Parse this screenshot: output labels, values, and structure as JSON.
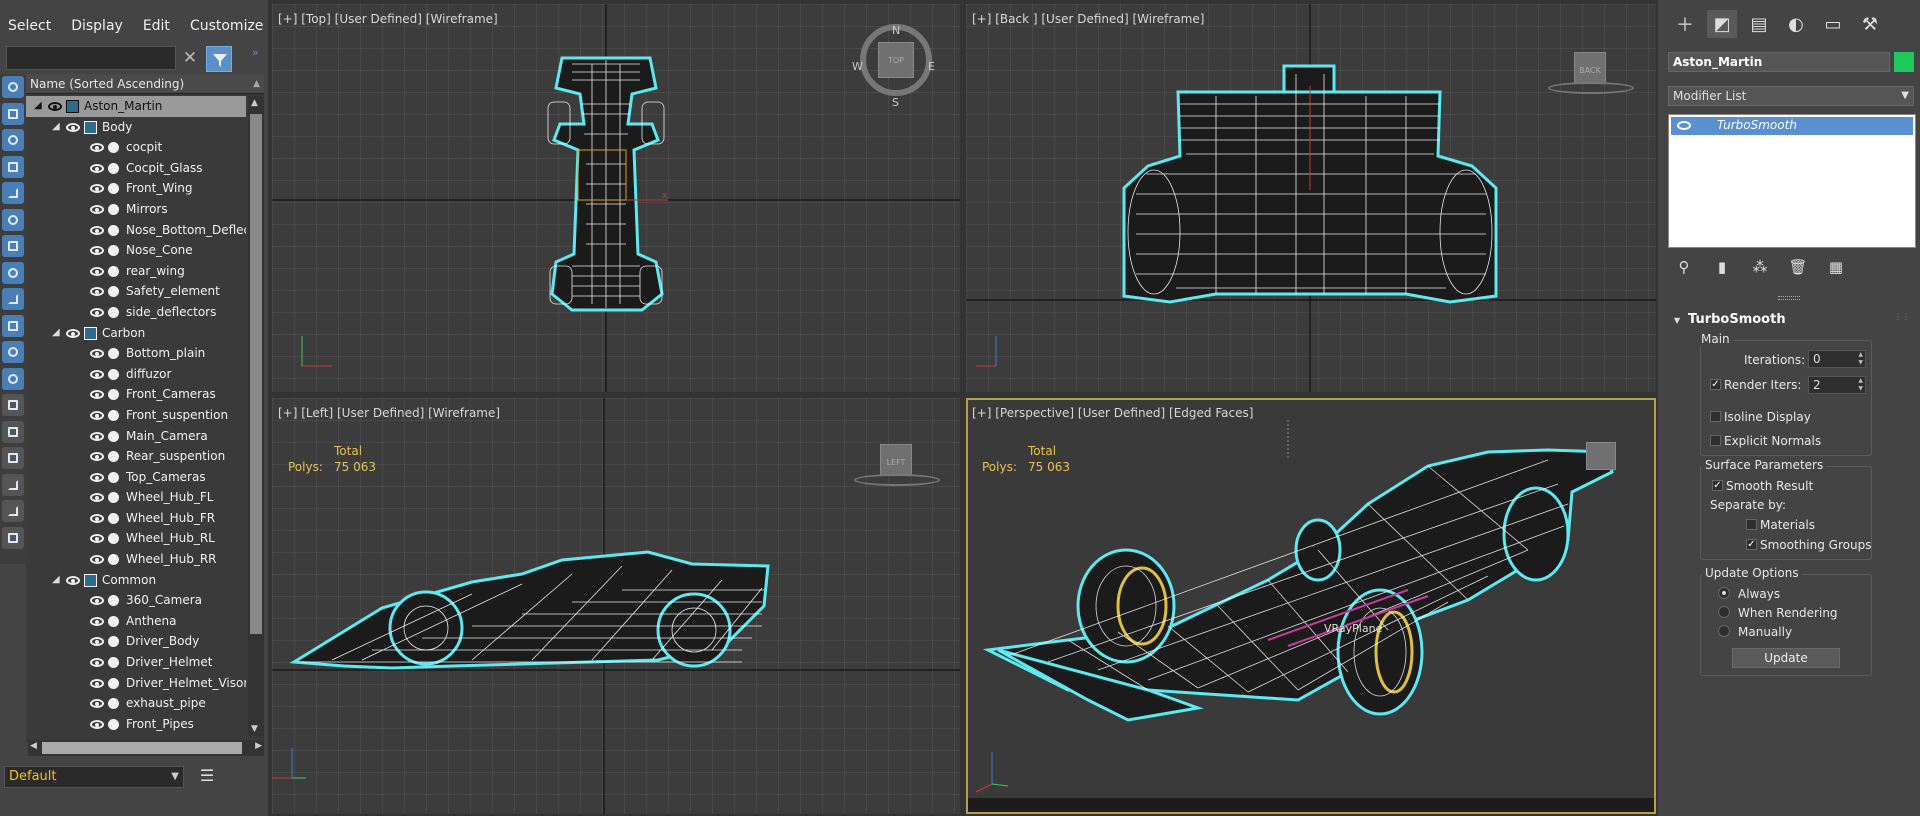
{
  "menu": [
    "Select",
    "Display",
    "Edit",
    "Customize"
  ],
  "explorer": {
    "search_value": "",
    "column_header": "Name (Sorted Ascending)",
    "rows": [
      {
        "label": "Aston_Martin",
        "level": 0,
        "type": "group",
        "selected": true
      },
      {
        "label": "Body",
        "level": 1,
        "type": "group"
      },
      {
        "label": "cocpit",
        "level": 2,
        "type": "obj"
      },
      {
        "label": "Cocpit_Glass",
        "level": 2,
        "type": "obj"
      },
      {
        "label": "Front_Wing",
        "level": 2,
        "type": "obj"
      },
      {
        "label": "Mirrors",
        "level": 2,
        "type": "obj"
      },
      {
        "label": "Nose_Bottom_Deflec",
        "level": 2,
        "type": "obj"
      },
      {
        "label": "Nose_Cone",
        "level": 2,
        "type": "obj"
      },
      {
        "label": "rear_wing",
        "level": 2,
        "type": "obj"
      },
      {
        "label": "Safety_element",
        "level": 2,
        "type": "obj"
      },
      {
        "label": "side_deflectors",
        "level": 2,
        "type": "obj"
      },
      {
        "label": "Carbon",
        "level": 1,
        "type": "group"
      },
      {
        "label": "Bottom_plain",
        "level": 2,
        "type": "obj"
      },
      {
        "label": "diffuzor",
        "level": 2,
        "type": "obj"
      },
      {
        "label": "Front_Cameras",
        "level": 2,
        "type": "obj"
      },
      {
        "label": "Front_suspention",
        "level": 2,
        "type": "obj"
      },
      {
        "label": "Main_Camera",
        "level": 2,
        "type": "obj"
      },
      {
        "label": "Rear_suspention",
        "level": 2,
        "type": "obj"
      },
      {
        "label": "Top_Cameras",
        "level": 2,
        "type": "obj"
      },
      {
        "label": "Wheel_Hub_FL",
        "level": 2,
        "type": "obj"
      },
      {
        "label": "Wheel_Hub_FR",
        "level": 2,
        "type": "obj"
      },
      {
        "label": "Wheel_Hub_RL",
        "level": 2,
        "type": "obj"
      },
      {
        "label": "Wheel_Hub_RR",
        "level": 2,
        "type": "obj"
      },
      {
        "label": "Common",
        "level": 1,
        "type": "group"
      },
      {
        "label": "360_Camera",
        "level": 2,
        "type": "obj"
      },
      {
        "label": "Anthena",
        "level": 2,
        "type": "obj"
      },
      {
        "label": "Driver_Body",
        "level": 2,
        "type": "obj"
      },
      {
        "label": "Driver_Helmet",
        "level": 2,
        "type": "obj"
      },
      {
        "label": "Driver_Helmet_Visor",
        "level": 2,
        "type": "obj"
      },
      {
        "label": "exhaust_pipe",
        "level": 2,
        "type": "obj"
      },
      {
        "label": "Front_Pipes",
        "level": 2,
        "type": "obj"
      }
    ],
    "layer": "Default"
  },
  "viewports": {
    "top": {
      "label": "[+] [Top] [User Defined] [Wireframe]",
      "cube": "TOP",
      "compass": {
        "n": "N",
        "s": "S",
        "e": "E",
        "w": "W"
      }
    },
    "back": {
      "label": "[+] [Back ] [User Defined] [Wireframe]",
      "cube": "BACK"
    },
    "left": {
      "label": "[+] [Left] [User Defined] [Wireframe]",
      "cube": "LEFT",
      "stats_total": "Total",
      "stats_polys_label": "Polys:",
      "stats_polys_value": "75 063"
    },
    "persp": {
      "label": "[+] [Perspective] [User Defined] [Edged Faces]",
      "stats_total": "Total",
      "stats_polys_label": "Polys:",
      "stats_polys_value": "75 063",
      "plane_label": "VRayPlane"
    }
  },
  "command_panel": {
    "object_name": "Aston_Martin",
    "object_color": "#1ec85a",
    "modifier_list": "Modifier List",
    "stack_item": "TurboSmooth",
    "rollout_title": "TurboSmooth",
    "main": {
      "title": "Main",
      "iterations_label": "Iterations:",
      "iterations_value": "0",
      "render_iters_label": "Render Iters:",
      "render_iters_value": "2",
      "render_iters_checked": true,
      "isoline_label": "Isoline Display",
      "explicit_normals_label": "Explicit Normals"
    },
    "surface": {
      "title": "Surface Parameters",
      "smooth_result_label": "Smooth Result",
      "separate_by_label": "Separate by:",
      "materials_label": "Materials",
      "smoothing_groups_label": "Smoothing Groups"
    },
    "update": {
      "title": "Update Options",
      "always_label": "Always",
      "when_rendering_label": "When Rendering",
      "manually_label": "Manually",
      "update_button": "Update"
    }
  },
  "colors": {
    "wire_cyan": "#5ee8f0",
    "active_border": "#b8a04a",
    "stats_yellow": "#e6c350",
    "selection_blue": "#5a8fd0"
  }
}
